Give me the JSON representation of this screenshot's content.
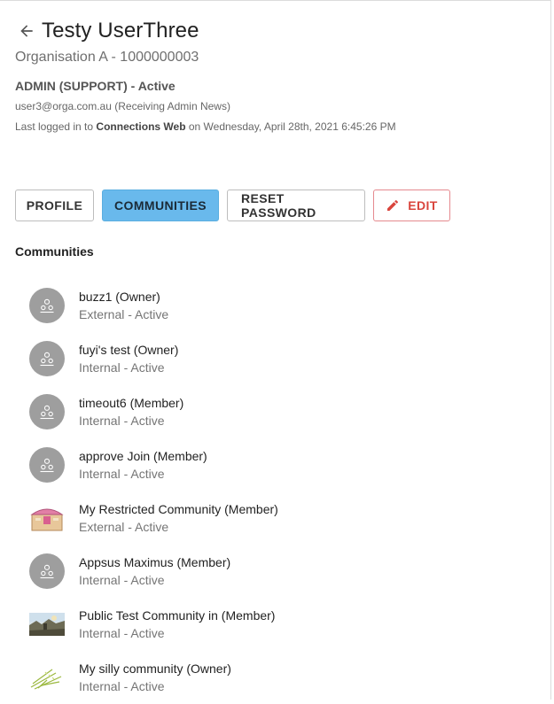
{
  "user": {
    "name": "Testy UserThree",
    "organisation": "Organisation A - 1000000003",
    "role": "ADMIN (SUPPORT) - Active",
    "email_line": "user3@orga.com.au (Receiving Admin News)",
    "last_login_prefix": "Last logged in to ",
    "last_login_app": "Connections Web",
    "last_login_suffix": " on Wednesday, April 28th, 2021 6:45:26 PM"
  },
  "tabs": {
    "profile": "PROFILE",
    "communities": "COMMUNITIES",
    "reset_password": "RESET PASSWORD",
    "edit": "EDIT"
  },
  "section_title": "Communities",
  "communities": [
    {
      "name": "buzz1 (Owner)",
      "status": "External - Active",
      "avatar": "default-community-icon"
    },
    {
      "name": "fuyi's test (Owner)",
      "status": "Internal - Active",
      "avatar": "default-community-icon"
    },
    {
      "name": "timeout6 (Member)",
      "status": "Internal - Active",
      "avatar": "default-community-icon"
    },
    {
      "name": "approve Join (Member)",
      "status": "Internal - Active",
      "avatar": "default-community-icon"
    },
    {
      "name": "My Restricted Community (Member)",
      "status": "External - Active",
      "avatar": "treasure-chest-image"
    },
    {
      "name": "Appsus Maximus (Member)",
      "status": "Internal - Active",
      "avatar": "default-community-icon"
    },
    {
      "name": "Public Test Community in (Member)",
      "status": "Internal - Active",
      "avatar": "landscape-photo"
    },
    {
      "name": "My silly community (Owner)",
      "status": "Internal - Active",
      "avatar": "grass-sketch-image"
    }
  ],
  "colors": {
    "accent": "#69b9ec",
    "edit": "#d9453d",
    "avatar_gray": "#9e9e9e"
  }
}
